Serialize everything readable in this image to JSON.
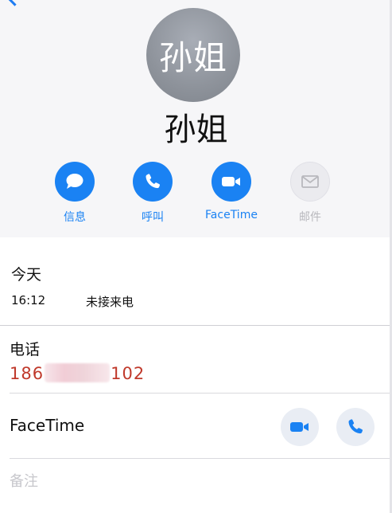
{
  "contact": {
    "avatar_text": "孙姐",
    "name": "孙姐"
  },
  "actions": [
    {
      "label": "信息",
      "icon": "message-icon",
      "enabled": true
    },
    {
      "label": "呼叫",
      "icon": "phone-icon",
      "enabled": true
    },
    {
      "label": "FaceTime",
      "icon": "video-camera-icon",
      "enabled": true
    },
    {
      "label": "邮件",
      "icon": "mail-icon",
      "enabled": false
    }
  ],
  "recents": {
    "title": "今天",
    "time": "16:12",
    "status": "未接来电"
  },
  "phone": {
    "title": "电话",
    "number_prefix": "186",
    "number_suffix": "102"
  },
  "facetime": {
    "title": "FaceTime",
    "video_icon": "video-camera-icon",
    "audio_icon": "phone-icon"
  },
  "notes": {
    "placeholder": "备注"
  },
  "colors": {
    "accent": "#1a82f3",
    "missed_number": "#c0392b",
    "avatar_bg": "#8e939b"
  }
}
